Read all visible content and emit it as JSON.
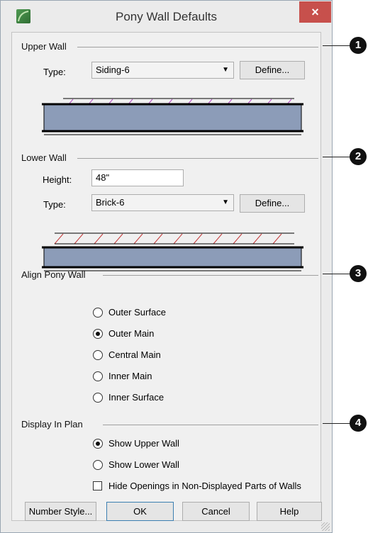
{
  "window": {
    "title": "Pony Wall Defaults",
    "close_glyph": "×"
  },
  "upper_wall": {
    "label": "Upper Wall",
    "type_label": "Type:",
    "type_value": "Siding-6",
    "define_label": "Define..."
  },
  "lower_wall": {
    "label": "Lower Wall",
    "height_label": "Height:",
    "height_value": "48\"",
    "type_label": "Type:",
    "type_value": "Brick-6",
    "define_label": "Define..."
  },
  "align": {
    "label": "Align Pony Wall",
    "options": [
      {
        "label": "Outer Surface",
        "selected": false
      },
      {
        "label": "Outer Main",
        "selected": true
      },
      {
        "label": "Central Main",
        "selected": false
      },
      {
        "label": "Inner Main",
        "selected": false
      },
      {
        "label": "Inner Surface",
        "selected": false
      }
    ]
  },
  "display": {
    "label": "Display In Plan",
    "options": [
      {
        "label": "Show Upper Wall",
        "selected": true
      },
      {
        "label": "Show Lower Wall",
        "selected": false
      }
    ],
    "hide_openings_label": "Hide Openings in Non-Displayed Parts of Walls",
    "hide_openings_checked": false
  },
  "buttons": {
    "number_style": "Number Style...",
    "ok": "OK",
    "cancel": "Cancel",
    "help": "Help"
  },
  "callouts": [
    "1",
    "2",
    "3",
    "4"
  ],
  "colors": {
    "wall_fill": "#8c9cb8",
    "siding_hatch": "#b44fc4",
    "brick_hatch": "#c43a3a",
    "close_button": "#c7504c"
  }
}
